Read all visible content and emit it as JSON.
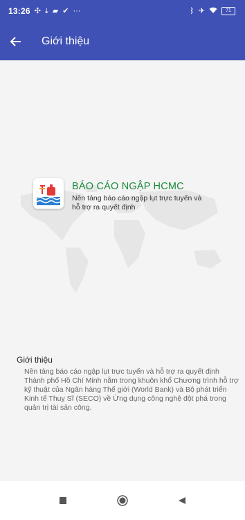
{
  "status_bar": {
    "time": "13:26",
    "dots": "···",
    "battery_level": "71",
    "icons_left": [
      "fan-icon",
      "download-icon",
      "message-icon",
      "check-circle-icon"
    ],
    "icons_right": [
      "bluetooth-icon",
      "airplane-icon",
      "wifi-icon",
      "battery-icon"
    ]
  },
  "app_bar": {
    "title": "Giới thiệu",
    "back_icon": "arrow-left-icon",
    "color": "#3f51b5"
  },
  "brand": {
    "title": "BÁO CÁO NGẬP HCMC",
    "subtitle": "Nền tảng báo cáo ngập lụt trực tuyến và hỗ trợ ra quyết định",
    "title_color": "#1a8a3c"
  },
  "intro": {
    "heading": "Giới thiệu",
    "body": "Nền tảng báo cáo ngập lụt trực tuyến và hỗ trợ ra quyết định Thành phố Hồ Chí Minh nằm trong khuôn khổ Chương trình hỗ trợ kỹ thuật của Ngân hàng Thế giới (World Bank) và Bộ phát triển Kinh tế Thuỵ Sĩ (SECO) về Ứng dụng công nghệ đột phá trong quản trị tài sản công."
  },
  "nav_bar": {
    "icons": [
      "recents-icon",
      "home-icon",
      "back-icon"
    ]
  }
}
